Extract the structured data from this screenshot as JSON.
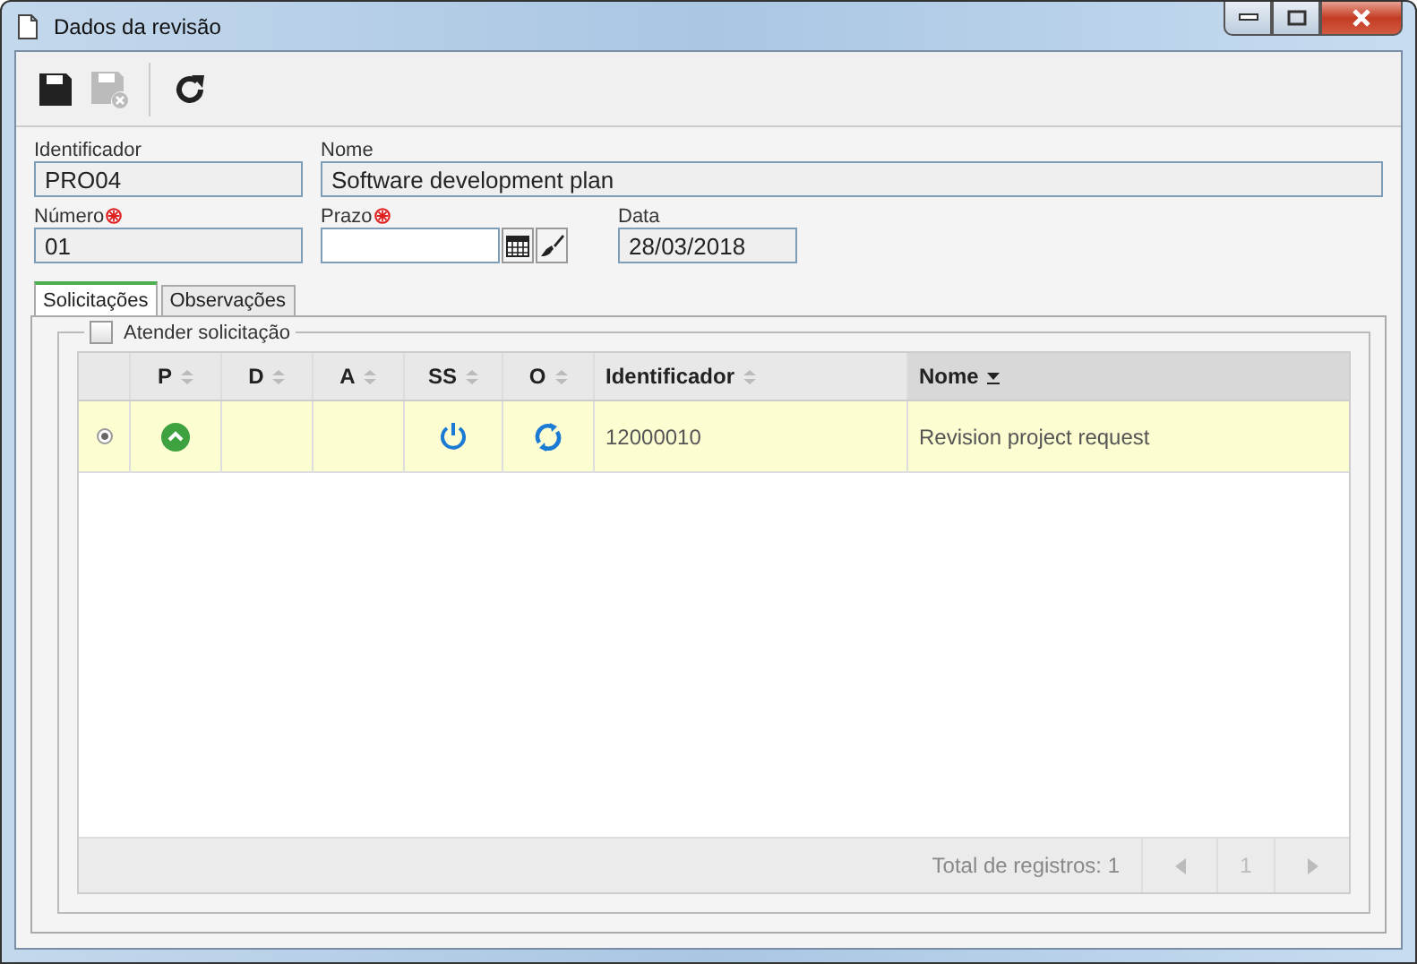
{
  "window": {
    "title": "Dados da revisão"
  },
  "toolbar": [
    {
      "kind": "save",
      "disabled": false
    },
    {
      "kind": "save-close",
      "disabled": true
    },
    {
      "kind": "refresh",
      "disabled": false
    }
  ],
  "fields": [
    {
      "label": "Identificador",
      "value": "PRO04",
      "required": false,
      "editable": false,
      "kind": "text"
    },
    {
      "label": "Nome",
      "value": "Software development plan",
      "required": false,
      "editable": false,
      "kind": "text"
    },
    {
      "label": "Número",
      "value": "01",
      "required": true,
      "editable": false,
      "kind": "text"
    },
    {
      "label": "Prazo",
      "required": true,
      "editable": true,
      "kind": "date"
    },
    {
      "label": "Data",
      "value": "28/03/2018",
      "required": false,
      "editable": false,
      "kind": "text"
    }
  ],
  "tabs": [
    {
      "label": "Solicitações",
      "selected": true
    },
    {
      "label": "Observações",
      "selected": false
    }
  ],
  "group": {
    "label": "Atender solicitação",
    "checked": false
  },
  "table": {
    "columns": [
      {
        "label": "P",
        "sorted": false
      },
      {
        "label": "D",
        "sorted": false
      },
      {
        "label": "A",
        "sorted": false
      },
      {
        "label": "SS",
        "sorted": false
      },
      {
        "label": "O",
        "sorted": false
      },
      {
        "label": "Identificador",
        "sorted": false
      },
      {
        "label": "Nome",
        "sorted": true
      }
    ],
    "rows": [
      {
        "selected": true,
        "icons": [
          {
            "kind": "up"
          },
          {
            "kind": "none"
          },
          {
            "kind": "none"
          },
          {
            "kind": "power"
          },
          {
            "kind": "sync"
          }
        ],
        "identificador": "12000010",
        "nome": "Revision project request"
      }
    ]
  },
  "footer": {
    "total": "Total de registros: 1",
    "page": "1"
  }
}
